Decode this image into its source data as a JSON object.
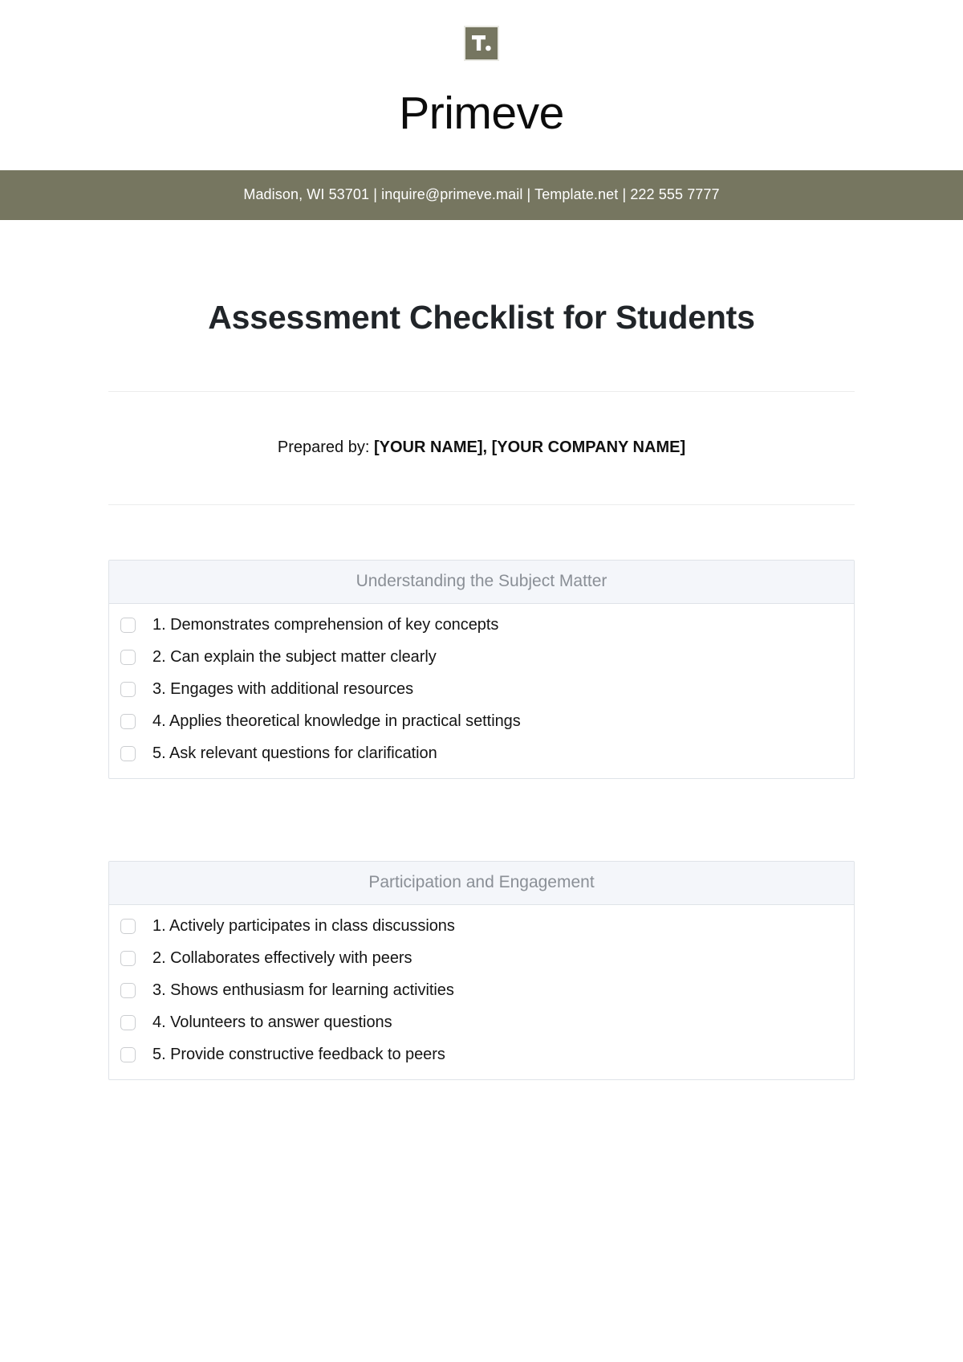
{
  "brand": {
    "logo_icon": "template-net-logo-icon",
    "logo_text": "T.",
    "logo_bg_color": "#767660",
    "company_name": "Primeve"
  },
  "contact_banner": {
    "bg_color": "#767660",
    "text": "Madison, WI 53701 | inquire@primeve.mail | Template.net | 222 555 7777"
  },
  "document": {
    "title": "Assessment Checklist for Students",
    "prepared_label": "Prepared by: ",
    "prepared_value": "[YOUR NAME], [YOUR COMPANY NAME]"
  },
  "sections": [
    {
      "heading": "Understanding the Subject Matter",
      "items": [
        {
          "text": "1. Demonstrates comprehension of key concepts",
          "checked": false
        },
        {
          "text": "2. Can explain the subject matter clearly",
          "checked": false
        },
        {
          "text": "3. Engages with additional resources",
          "checked": false
        },
        {
          "text": "4. Applies theoretical knowledge in practical settings",
          "checked": false
        },
        {
          "text": "5. Ask relevant questions for clarification",
          "checked": false
        }
      ]
    },
    {
      "heading": "Participation and Engagement",
      "items": [
        {
          "text": "1. Actively participates in class discussions",
          "checked": false
        },
        {
          "text": "2. Collaborates effectively with peers",
          "checked": false
        },
        {
          "text": "3. Shows enthusiasm for learning activities",
          "checked": false
        },
        {
          "text": "4. Volunteers to answer questions",
          "checked": false
        },
        {
          "text": "5. Provide constructive feedback to peers",
          "checked": false
        }
      ]
    }
  ]
}
